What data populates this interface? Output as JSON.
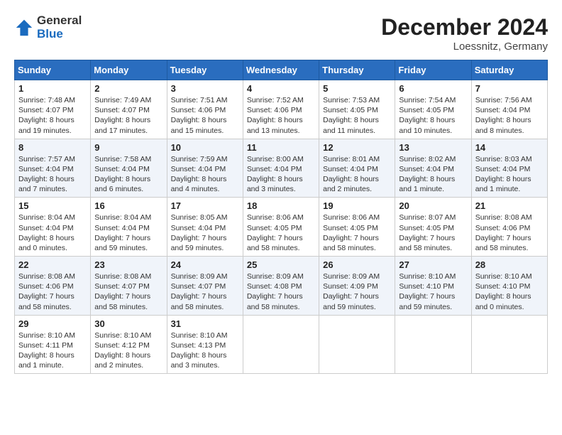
{
  "header": {
    "logo_general": "General",
    "logo_blue": "Blue",
    "month_title": "December 2024",
    "location": "Loessnitz, Germany"
  },
  "days_of_week": [
    "Sunday",
    "Monday",
    "Tuesday",
    "Wednesday",
    "Thursday",
    "Friday",
    "Saturday"
  ],
  "weeks": [
    [
      {
        "day": "1",
        "sunrise": "Sunrise: 7:48 AM",
        "sunset": "Sunset: 4:07 PM",
        "daylight": "Daylight: 8 hours and 19 minutes."
      },
      {
        "day": "2",
        "sunrise": "Sunrise: 7:49 AM",
        "sunset": "Sunset: 4:07 PM",
        "daylight": "Daylight: 8 hours and 17 minutes."
      },
      {
        "day": "3",
        "sunrise": "Sunrise: 7:51 AM",
        "sunset": "Sunset: 4:06 PM",
        "daylight": "Daylight: 8 hours and 15 minutes."
      },
      {
        "day": "4",
        "sunrise": "Sunrise: 7:52 AM",
        "sunset": "Sunset: 4:06 PM",
        "daylight": "Daylight: 8 hours and 13 minutes."
      },
      {
        "day": "5",
        "sunrise": "Sunrise: 7:53 AM",
        "sunset": "Sunset: 4:05 PM",
        "daylight": "Daylight: 8 hours and 11 minutes."
      },
      {
        "day": "6",
        "sunrise": "Sunrise: 7:54 AM",
        "sunset": "Sunset: 4:05 PM",
        "daylight": "Daylight: 8 hours and 10 minutes."
      },
      {
        "day": "7",
        "sunrise": "Sunrise: 7:56 AM",
        "sunset": "Sunset: 4:04 PM",
        "daylight": "Daylight: 8 hours and 8 minutes."
      }
    ],
    [
      {
        "day": "8",
        "sunrise": "Sunrise: 7:57 AM",
        "sunset": "Sunset: 4:04 PM",
        "daylight": "Daylight: 8 hours and 7 minutes."
      },
      {
        "day": "9",
        "sunrise": "Sunrise: 7:58 AM",
        "sunset": "Sunset: 4:04 PM",
        "daylight": "Daylight: 8 hours and 6 minutes."
      },
      {
        "day": "10",
        "sunrise": "Sunrise: 7:59 AM",
        "sunset": "Sunset: 4:04 PM",
        "daylight": "Daylight: 8 hours and 4 minutes."
      },
      {
        "day": "11",
        "sunrise": "Sunrise: 8:00 AM",
        "sunset": "Sunset: 4:04 PM",
        "daylight": "Daylight: 8 hours and 3 minutes."
      },
      {
        "day": "12",
        "sunrise": "Sunrise: 8:01 AM",
        "sunset": "Sunset: 4:04 PM",
        "daylight": "Daylight: 8 hours and 2 minutes."
      },
      {
        "day": "13",
        "sunrise": "Sunrise: 8:02 AM",
        "sunset": "Sunset: 4:04 PM",
        "daylight": "Daylight: 8 hours and 1 minute."
      },
      {
        "day": "14",
        "sunrise": "Sunrise: 8:03 AM",
        "sunset": "Sunset: 4:04 PM",
        "daylight": "Daylight: 8 hours and 1 minute."
      }
    ],
    [
      {
        "day": "15",
        "sunrise": "Sunrise: 8:04 AM",
        "sunset": "Sunset: 4:04 PM",
        "daylight": "Daylight: 8 hours and 0 minutes."
      },
      {
        "day": "16",
        "sunrise": "Sunrise: 8:04 AM",
        "sunset": "Sunset: 4:04 PM",
        "daylight": "Daylight: 7 hours and 59 minutes."
      },
      {
        "day": "17",
        "sunrise": "Sunrise: 8:05 AM",
        "sunset": "Sunset: 4:04 PM",
        "daylight": "Daylight: 7 hours and 59 minutes."
      },
      {
        "day": "18",
        "sunrise": "Sunrise: 8:06 AM",
        "sunset": "Sunset: 4:05 PM",
        "daylight": "Daylight: 7 hours and 58 minutes."
      },
      {
        "day": "19",
        "sunrise": "Sunrise: 8:06 AM",
        "sunset": "Sunset: 4:05 PM",
        "daylight": "Daylight: 7 hours and 58 minutes."
      },
      {
        "day": "20",
        "sunrise": "Sunrise: 8:07 AM",
        "sunset": "Sunset: 4:05 PM",
        "daylight": "Daylight: 7 hours and 58 minutes."
      },
      {
        "day": "21",
        "sunrise": "Sunrise: 8:08 AM",
        "sunset": "Sunset: 4:06 PM",
        "daylight": "Daylight: 7 hours and 58 minutes."
      }
    ],
    [
      {
        "day": "22",
        "sunrise": "Sunrise: 8:08 AM",
        "sunset": "Sunset: 4:06 PM",
        "daylight": "Daylight: 7 hours and 58 minutes."
      },
      {
        "day": "23",
        "sunrise": "Sunrise: 8:08 AM",
        "sunset": "Sunset: 4:07 PM",
        "daylight": "Daylight: 7 hours and 58 minutes."
      },
      {
        "day": "24",
        "sunrise": "Sunrise: 8:09 AM",
        "sunset": "Sunset: 4:07 PM",
        "daylight": "Daylight: 7 hours and 58 minutes."
      },
      {
        "day": "25",
        "sunrise": "Sunrise: 8:09 AM",
        "sunset": "Sunset: 4:08 PM",
        "daylight": "Daylight: 7 hours and 58 minutes."
      },
      {
        "day": "26",
        "sunrise": "Sunrise: 8:09 AM",
        "sunset": "Sunset: 4:09 PM",
        "daylight": "Daylight: 7 hours and 59 minutes."
      },
      {
        "day": "27",
        "sunrise": "Sunrise: 8:10 AM",
        "sunset": "Sunset: 4:10 PM",
        "daylight": "Daylight: 7 hours and 59 minutes."
      },
      {
        "day": "28",
        "sunrise": "Sunrise: 8:10 AM",
        "sunset": "Sunset: 4:10 PM",
        "daylight": "Daylight: 8 hours and 0 minutes."
      }
    ],
    [
      {
        "day": "29",
        "sunrise": "Sunrise: 8:10 AM",
        "sunset": "Sunset: 4:11 PM",
        "daylight": "Daylight: 8 hours and 1 minute."
      },
      {
        "day": "30",
        "sunrise": "Sunrise: 8:10 AM",
        "sunset": "Sunset: 4:12 PM",
        "daylight": "Daylight: 8 hours and 2 minutes."
      },
      {
        "day": "31",
        "sunrise": "Sunrise: 8:10 AM",
        "sunset": "Sunset: 4:13 PM",
        "daylight": "Daylight: 8 hours and 3 minutes."
      },
      null,
      null,
      null,
      null
    ]
  ]
}
